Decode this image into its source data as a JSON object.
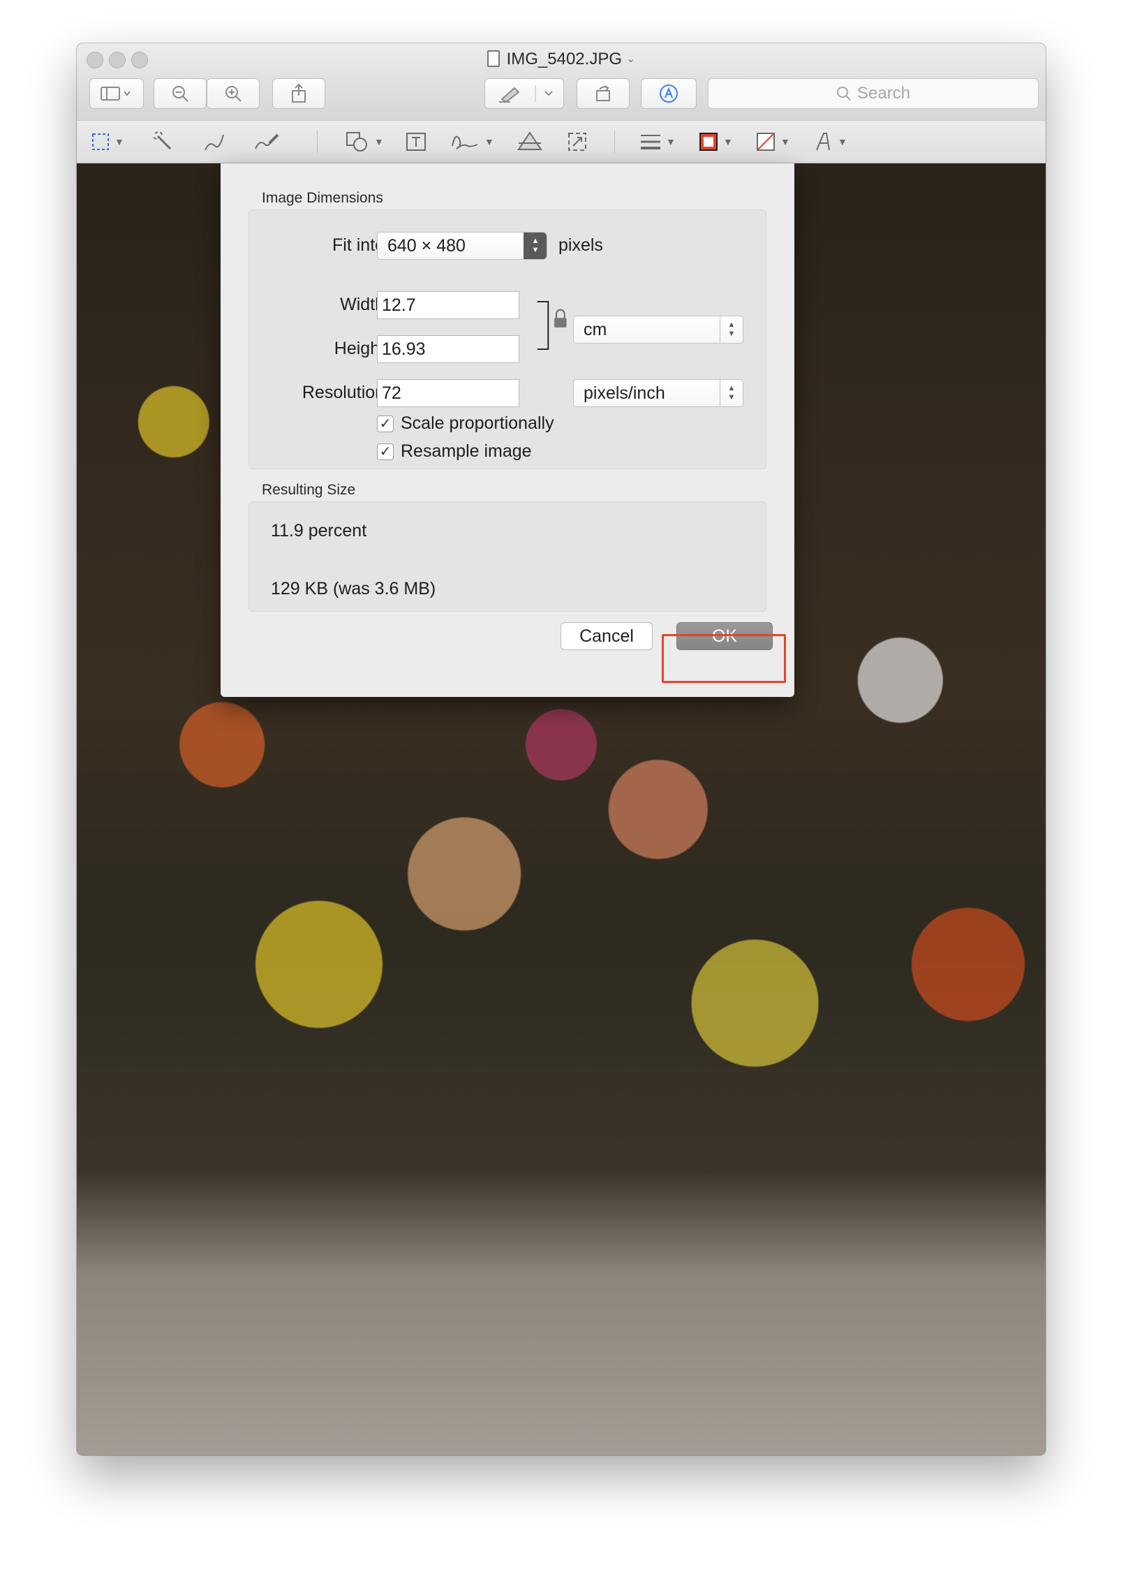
{
  "window": {
    "title": "IMG_5402.JPG",
    "title_chevron": "⌄"
  },
  "toolbar": {
    "search_placeholder": "Search"
  },
  "dialog": {
    "image_dimensions_title": "Image Dimensions",
    "fit_into_label": "Fit into:",
    "fit_into_value": "640 × 480",
    "fit_into_unit": "pixels",
    "width_label": "Width:",
    "width_value": "12.7",
    "height_label": "Height:",
    "height_value": "16.93",
    "resolution_label": "Resolution:",
    "resolution_value": "72",
    "size_unit_value": "cm",
    "resolution_unit_value": "pixels/inch",
    "scale_proportionally_label": "Scale proportionally",
    "scale_proportionally_checked": true,
    "resample_image_label": "Resample image",
    "resample_image_checked": true,
    "resulting_size_title": "Resulting Size",
    "result_percent": "11.9 percent",
    "result_size": "129 KB (was 3.6 MB)",
    "cancel_label": "Cancel",
    "ok_label": "OK"
  },
  "colors": {
    "highlight": "#e3452d",
    "ok_button": "#8a8a8a",
    "dialog_bg": "#ececec"
  }
}
